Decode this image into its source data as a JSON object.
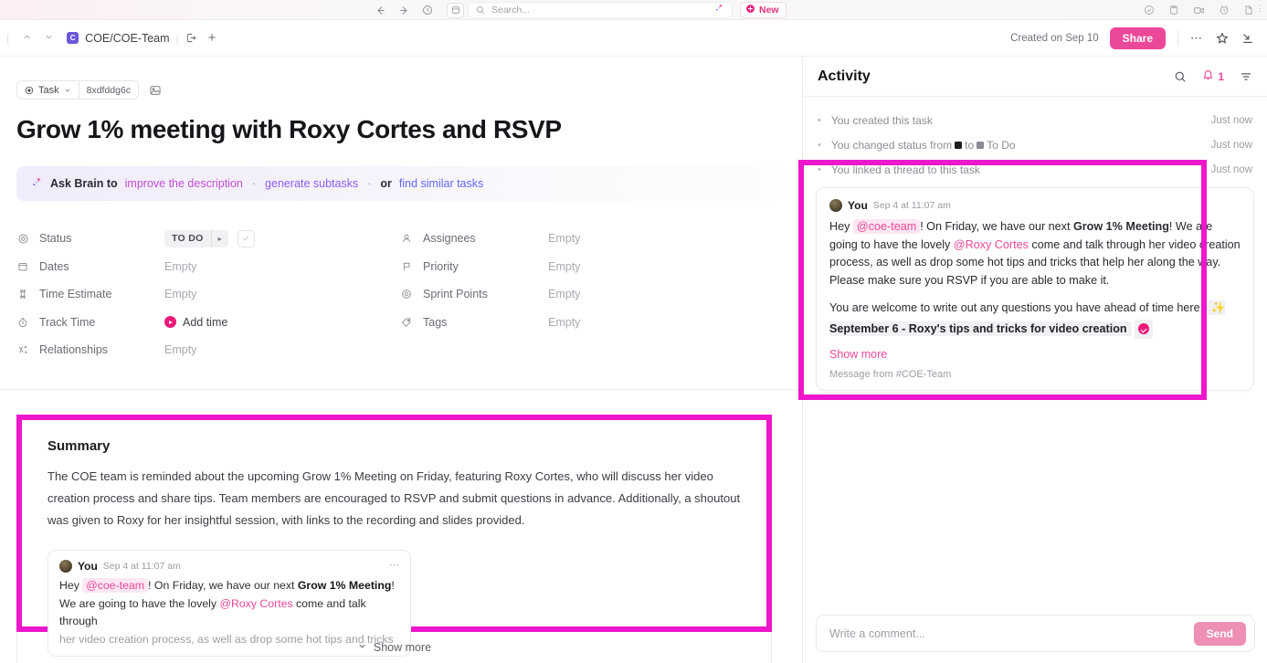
{
  "topbar": {
    "nav": {
      "back_icon": "arrow-left-icon",
      "forward_icon": "arrow-right-icon",
      "history_icon": "clock-icon",
      "panel_icon": "sidebar-panel-icon"
    },
    "search": {
      "placeholder": "Search...",
      "icon": "search-icon",
      "brain_icon": "ai-sparkle-icon"
    },
    "new_button": {
      "label": "New",
      "icon": "plus-circle-icon"
    },
    "right_icons": [
      "check-circle-icon",
      "clipboard-icon",
      "video-camera-icon",
      "alarm-clock-icon",
      "document-icon"
    ],
    "overflow_icon": "vertical-dots-icon"
  },
  "breadcrumb": {
    "up_icon": "chevron-up-icon",
    "down_icon": "chevron-down-icon",
    "space_initial": "C",
    "space": "COE",
    "slash": "/",
    "list": "COE-Team",
    "open_icon": "open-in-icon",
    "plus_icon": "plus-icon"
  },
  "header_right": {
    "created": "Created on Sep 10",
    "share_label": "Share",
    "more_icon": "ellipsis-icon",
    "star_icon": "star-icon",
    "collapse_icon": "collapse-icon"
  },
  "task": {
    "type_chip": {
      "label": "Task",
      "icon": "task-circle-icon",
      "caret": "chevron-down-icon"
    },
    "id_chip": "8xdfddg6c",
    "cover_icon": "image-icon",
    "title": "Grow 1% meeting with Roxy Cortes and RSVP"
  },
  "brain_banner": {
    "icon": "ai-sparkle-icon",
    "lead": "Ask Brain to",
    "link1": "improve the description",
    "sep1": "·",
    "link2": "generate subtasks",
    "sep2": "·",
    "or": "or",
    "link3": "find similar tasks"
  },
  "fields": {
    "left": [
      {
        "icon": "status-target-icon",
        "label": "Status",
        "value": "",
        "status": {
          "label": "TO DO",
          "caret": "▸"
        },
        "check_icon": "check-icon"
      },
      {
        "icon": "calendar-icon",
        "label": "Dates",
        "value": "Empty"
      },
      {
        "icon": "hourglass-icon",
        "label": "Time Estimate",
        "value": "Empty"
      },
      {
        "icon": "stopwatch-icon",
        "label": "Track Time",
        "value": "Add time",
        "track": true
      },
      {
        "icon": "relationship-icon",
        "label": "Relationships",
        "value": "Empty"
      }
    ],
    "right": [
      {
        "icon": "person-icon",
        "label": "Assignees",
        "value": "Empty"
      },
      {
        "icon": "flag-icon",
        "label": "Priority",
        "value": "Empty"
      },
      {
        "icon": "sprint-points-icon",
        "label": "Sprint Points",
        "value": "Empty"
      },
      {
        "icon": "tag-icon",
        "label": "Tags",
        "value": "Empty"
      }
    ]
  },
  "summary": {
    "heading": "Summary",
    "paragraph": "The COE team is reminded about the upcoming Grow 1% Meeting on Friday, featuring Roxy Cortes, who will discuss her video creation process and share tips. Team members are encouraged to RSVP and submit questions in advance. Additionally, a shoutout was given to Roxy for her insightful session, with links to the recording and slides provided.",
    "message": {
      "author": "You",
      "timestamp": "Sep 4 at 11:07 am",
      "more_icon": "ellipsis-icon",
      "line1_a": "Hey",
      "mention_team": "@coe-team",
      "line1_b": "! On Friday, we have our next",
      "bold1": "Grow 1% Meeting",
      "line1_c": "!",
      "line2_a": "We are going to have the lovely",
      "mention_user": "@Roxy Cortes",
      "line2_b": "come and talk through",
      "line3": "her video creation process, as well as drop some hot tips and tricks"
    },
    "show_more": "Show more",
    "show_more_caret": "chevron-down-icon"
  },
  "activity": {
    "title": "Activity",
    "search_icon": "search-icon",
    "bell_icon": "bell-icon",
    "bell_count": "1",
    "filter_icon": "filter-icon",
    "entries": [
      {
        "text": "You created this task",
        "when": "Just now"
      },
      {
        "text_a": "You changed status from",
        "swatch_from": "#1f1f23",
        "text_b": "to",
        "swatch_to": "#8b8b93",
        "text_c": "To Do",
        "when": "Just now"
      },
      {
        "text": "You linked a thread to this task",
        "when": "Just now"
      }
    ],
    "thread": {
      "author": "You",
      "timestamp": "Sep 4 at 11:07 am",
      "p1_a": "Hey",
      "mention_team": "@coe-team",
      "p1_b": "! On Friday, we have our next",
      "bold1": "Grow 1% Meeting",
      "p1_c": "!",
      "p1_d": "We are going to have the lovely",
      "mention_user": "@Roxy Cortes",
      "p1_e": "come and talk through her video creation process, as well as drop some hot tips and tricks that help her along the way. Please make sure you RSVP if you are able to make it.",
      "p2_a": "You are welcome to write out any questions you have ahead of time here:",
      "link_emoji": "✨",
      "link_text": "September 6 - Roxy's tips and tricks for video creation",
      "check_icon": "pink-check-icon",
      "show_more": "Show more",
      "source": "Message from #COE-Team"
    },
    "comment": {
      "placeholder": "Write a comment...",
      "send_label": "Send"
    }
  },
  "colors": {
    "accent_pink": "#EC4899",
    "highlight_magenta": "#EE17CC",
    "brand_purple": "#6D55D7",
    "send_pink": "#EE8FB5"
  }
}
